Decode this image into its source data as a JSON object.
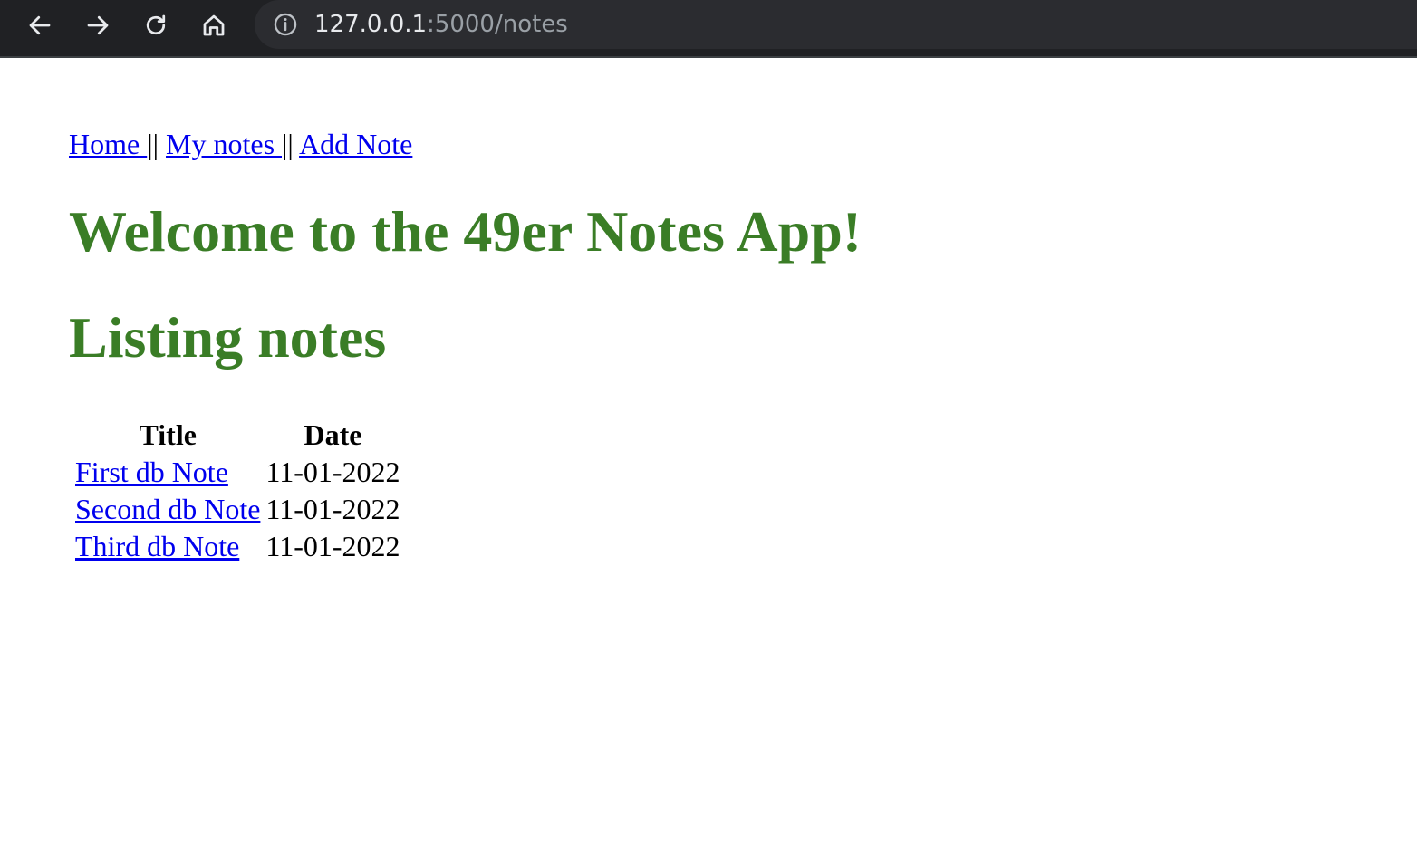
{
  "browser": {
    "url_host": "127.0.0.1",
    "url_path": ":5000/notes"
  },
  "nav": {
    "home": "Home ",
    "my_notes": "My notes ",
    "add_note": "Add Note",
    "separator": "||"
  },
  "page": {
    "welcome": "Welcome to the 49er Notes App!",
    "listing": "Listing notes"
  },
  "table": {
    "headers": [
      "Title",
      "Date"
    ],
    "rows": [
      {
        "title": "First db Note",
        "date": "11-01-2022"
      },
      {
        "title": "Second db Note",
        "date": "11-01-2022"
      },
      {
        "title": "Third db Note",
        "date": "11-01-2022"
      }
    ]
  },
  "colors": {
    "heading": "#3a7d26",
    "link": "#0000ee",
    "toolbar": "#202124"
  }
}
